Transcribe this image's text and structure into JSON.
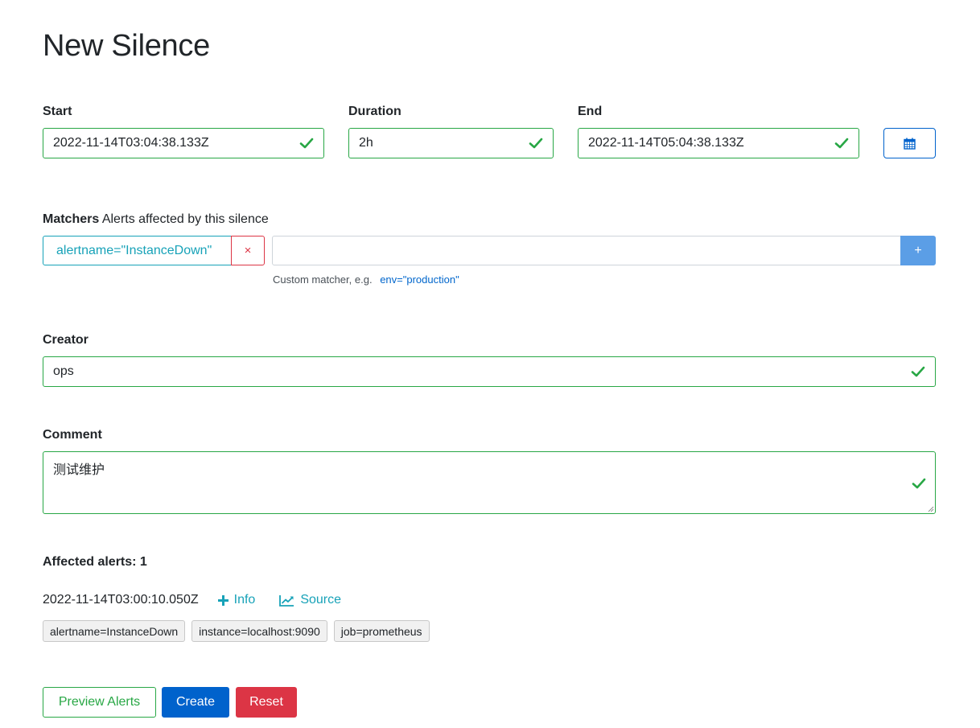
{
  "page": {
    "title": "New Silence"
  },
  "start": {
    "label": "Start",
    "value": "2022-11-14T03:04:38.133Z"
  },
  "duration": {
    "label": "Duration",
    "value": "2h"
  },
  "end": {
    "label": "End",
    "value": "2022-11-14T05:04:38.133Z",
    "picker_icon": "calendar-icon"
  },
  "matchers": {
    "label": "Matchers",
    "description": "Alerts affected by this silence",
    "items": [
      {
        "text": "alertname=\"InstanceDown\"",
        "remove_symbol": "×"
      }
    ],
    "new_matcher_value": "",
    "add_symbol": "+",
    "hint": "Custom matcher, e.g.",
    "hint_example": "env=\"production\""
  },
  "creator": {
    "label": "Creator",
    "value": "ops"
  },
  "comment": {
    "label": "Comment",
    "value": "测试维护"
  },
  "affected": {
    "title": "Affected alerts: 1",
    "alerts": [
      {
        "time": "2022-11-14T03:00:10.050Z",
        "info_label": "Info",
        "source_label": "Source",
        "labels": [
          "alertname=InstanceDown",
          "instance=localhost:9090",
          "job=prometheus"
        ]
      }
    ]
  },
  "actions": {
    "preview_label": "Preview Alerts",
    "create_label": "Create",
    "reset_label": "Reset"
  },
  "colors": {
    "valid": "#28a745",
    "primary": "#0062cc",
    "danger": "#dc3545",
    "info": "#17a2b8"
  }
}
